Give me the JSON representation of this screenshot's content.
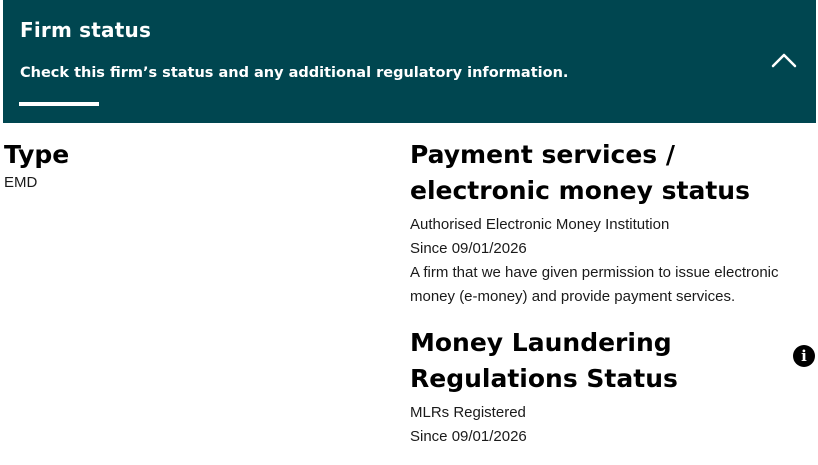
{
  "banner": {
    "title": "Firm status",
    "subtitle": "Check this firm’s status and any additional regulatory information.",
    "background_color": "#004650",
    "collapse_icon": "chevron-up-icon"
  },
  "type_section": {
    "heading": "Type",
    "value": "EMD"
  },
  "payment_status": {
    "heading": "Payment services / electronic money status",
    "status": "Authorised Electronic Money Institution",
    "since": "Since 09/01/2026",
    "description": "A firm that we have given permission to issue electronic money (e-money) and provide payment services."
  },
  "mlr_status": {
    "heading": "Money Laundering Regulations Status",
    "status": "MLRs Registered",
    "since": "Since 09/01/2026",
    "info_icon": "info-icon"
  }
}
